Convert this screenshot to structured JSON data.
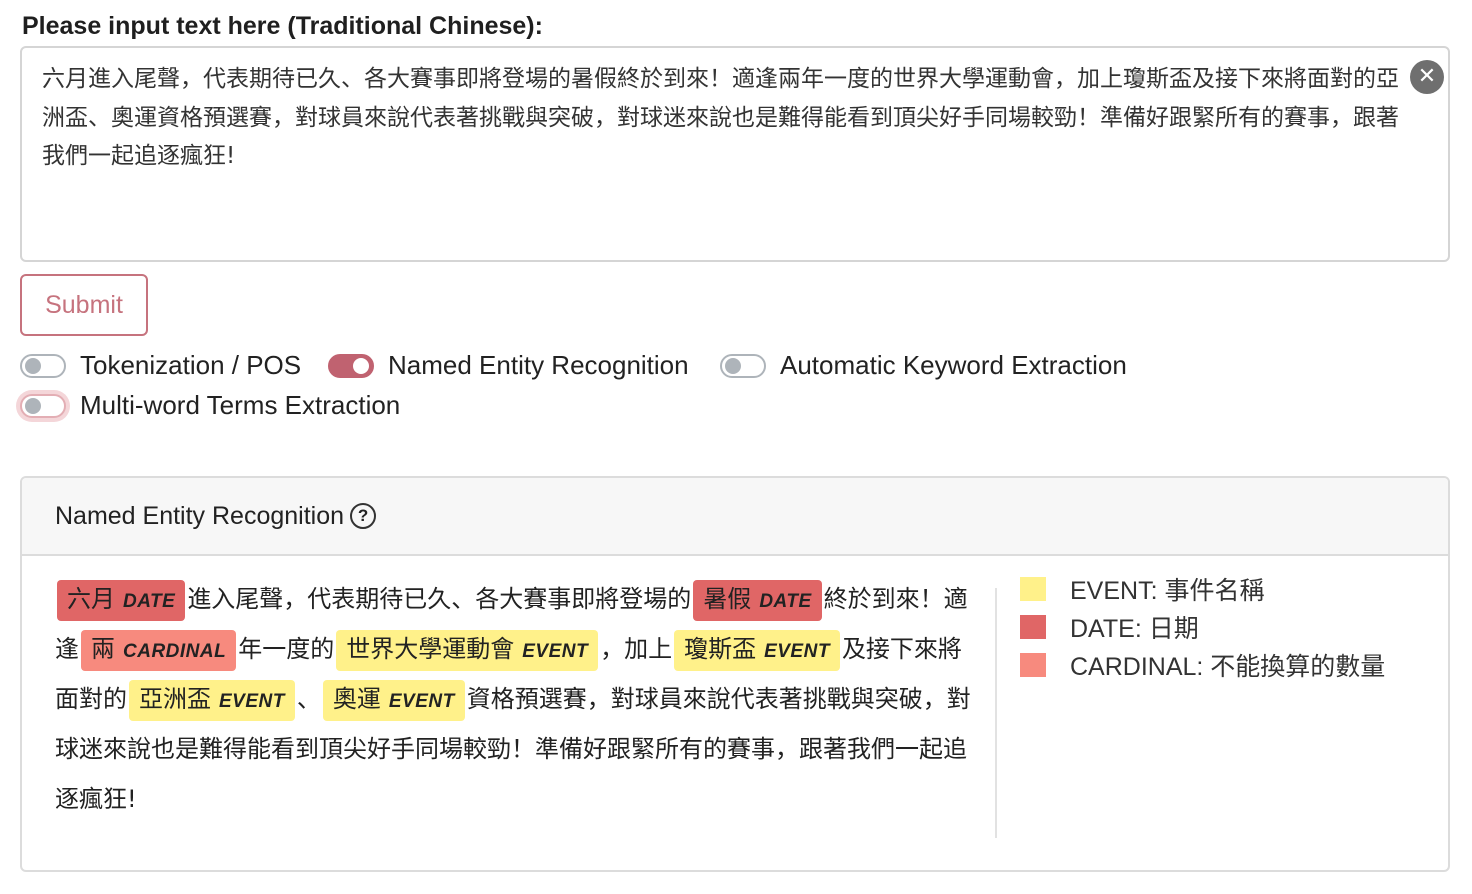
{
  "input": {
    "label": "Please input text here (Traditional Chinese):",
    "value": "六月進入尾聲，代表期待已久、各大賽事即將登場的暑假終於到來！適逢兩年一度的世界大學運動會，加上瓊斯盃及接下來將面對的亞洲盃、奧運資格預選賽，對球員來說代表著挑戰與突破，對球迷來說也是難得能看到頂尖好手同場較勁！準備好跟緊所有的賽事，跟著我們一起追逐瘋狂!",
    "clear_icon": "✕"
  },
  "submit_label": "Submit",
  "toggles": [
    {
      "label": "Tokenization / POS",
      "on": false
    },
    {
      "label": "Named Entity Recognition",
      "on": true
    },
    {
      "label": "Automatic Keyword Extraction",
      "on": false
    },
    {
      "label": "Multi-word Terms Extraction",
      "on": false
    }
  ],
  "ner": {
    "title": "Named Entity Recognition",
    "help_icon": "?",
    "segments": [
      {
        "text": "六月",
        "label": "DATE"
      },
      {
        "text": "進入尾聲，代表期待已久、各大賽事即將登場的"
      },
      {
        "text": "暑假",
        "label": "DATE"
      },
      {
        "text": "終於到來！適逢"
      },
      {
        "text": "兩",
        "label": "CARDINAL"
      },
      {
        "text": "年一度的"
      },
      {
        "text": "世界大學運動會",
        "label": "EVENT"
      },
      {
        "text": "，加上"
      },
      {
        "text": "瓊斯盃",
        "label": "EVENT"
      },
      {
        "text": "及接下來將面對的"
      },
      {
        "text": "亞洲盃",
        "label": "EVENT"
      },
      {
        "text": "、"
      },
      {
        "text": "奧運",
        "label": "EVENT"
      },
      {
        "text": "資格預選賽，對球員來說代表著挑戰與突破，對球迷來說也是難得能看到頂尖好手同場較勁！準備好跟緊所有的賽事，跟著我們一起追逐瘋狂!"
      }
    ],
    "legend": [
      {
        "label": "EVENT: 事件名稱",
        "color": "#fff18a"
      },
      {
        "label": "DATE: 日期",
        "color": "#e06666"
      },
      {
        "label": "CARDINAL: 不能換算的數量",
        "color": "#f78a7e"
      }
    ]
  },
  "colors": {
    "accent": "#c06270",
    "submit_border": "#c6737e"
  }
}
